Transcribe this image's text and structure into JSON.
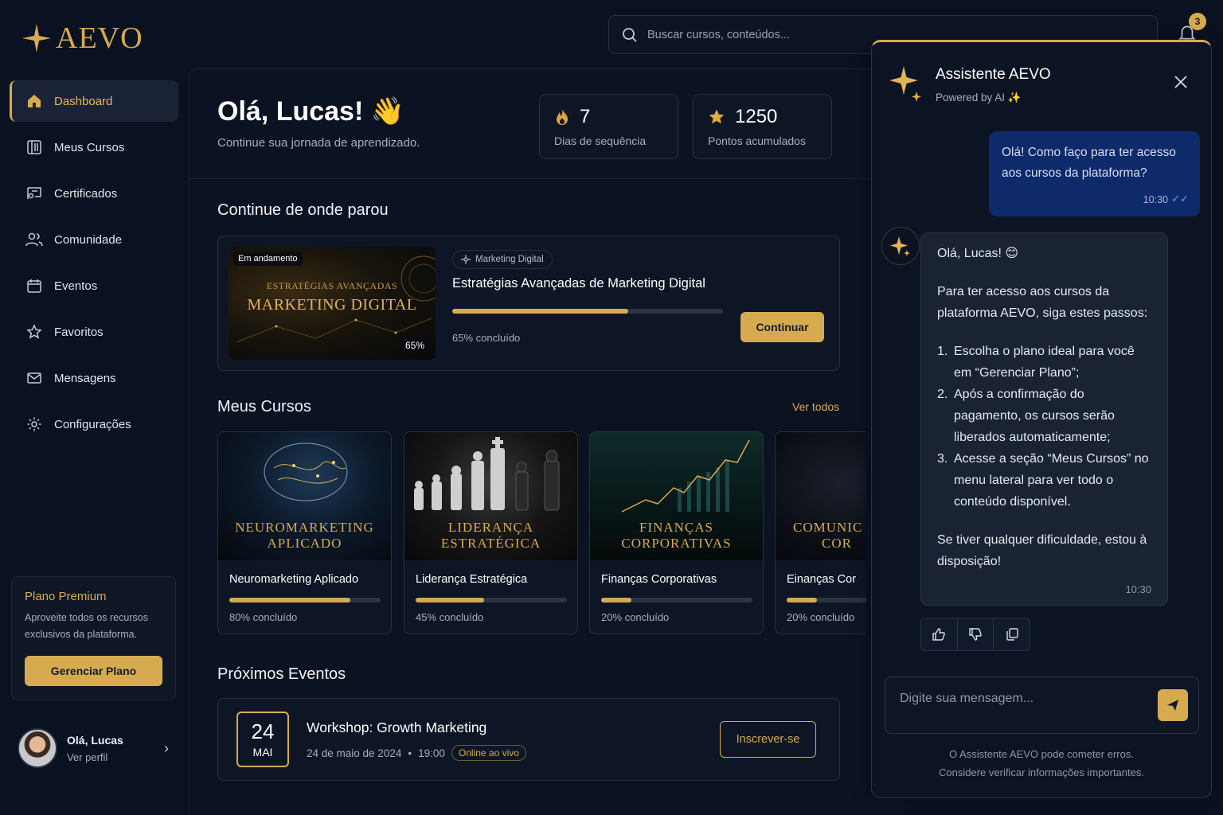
{
  "brand": {
    "name": "AEVO",
    "accent": "#d6ab4f"
  },
  "search": {
    "placeholder": "Buscar cursos, conteúdos..."
  },
  "notifications": {
    "count": "3"
  },
  "sidebar": {
    "items": [
      {
        "label": "Dashboard",
        "icon": "home-icon",
        "active": true
      },
      {
        "label": "Meus Cursos",
        "icon": "books-icon"
      },
      {
        "label": "Certificados",
        "icon": "certificate-icon"
      },
      {
        "label": "Comunidade",
        "icon": "users-icon"
      },
      {
        "label": "Eventos",
        "icon": "calendar-icon"
      },
      {
        "label": "Favoritos",
        "icon": "star-icon"
      },
      {
        "label": "Mensagens",
        "icon": "mail-icon"
      },
      {
        "label": "Configurações",
        "icon": "gear-icon"
      }
    ],
    "plan": {
      "title": "Plano Premium",
      "description": "Aproveite todos os recursos exclusivos da plataforma.",
      "button": "Gerenciar Plano"
    },
    "profile": {
      "name": "Olá, Lucas",
      "link": "Ver perfil"
    }
  },
  "header": {
    "greeting": "Olá, Lucas! 👋",
    "subtitle": "Continue sua jornada de aprendizado.",
    "stats": [
      {
        "value": "7",
        "label": "Dias de sequência",
        "icon": "fire-icon"
      },
      {
        "value": "1250",
        "label": "Pontos acumulados",
        "icon": "star-icon"
      }
    ]
  },
  "continue": {
    "section_title": "Continue de onde parou",
    "badge": "Em andamento",
    "thumb_small": "ESTRATÉGIAS AVANÇADAS",
    "thumb_big": "MARKETING DIGITAL",
    "thumb_pct": "65%",
    "category": "Marketing Digital",
    "title": "Estratégias Avançadas de Marketing Digital",
    "progress": 65,
    "progress_text": "65% concluído",
    "button": "Continuar"
  },
  "courses": {
    "section_title": "Meus Cursos",
    "see_all": "Ver todos",
    "items": [
      {
        "caption_line1": "NEUROMARKETING",
        "caption_line2": "APLICADO",
        "name": "Neuromarketing Aplicado",
        "progress": 80,
        "progress_text": "80% concluído"
      },
      {
        "caption_line1": "LIDERANÇA",
        "caption_line2": "ESTRATÉGICA",
        "name": "Liderança Estratégica",
        "progress": 45,
        "progress_text": "45% concluído"
      },
      {
        "caption_line1": "FINANÇAS",
        "caption_line2": "CORPORATIVAS",
        "name": "Finanças Corporativas",
        "progress": 20,
        "progress_text": "20% concluído"
      },
      {
        "caption_line1": "COMUNIC",
        "caption_line2": "COR",
        "name": "Einanças Cor",
        "progress": 20,
        "progress_text": "20% concluído"
      }
    ]
  },
  "events": {
    "section_title": "Próximos Eventos",
    "items": [
      {
        "day": "24",
        "month": "MAI",
        "title": "Workshop: Growth Marketing",
        "date": "24 de maio de 2024",
        "time": "19:00",
        "tag": "Online ao vivo",
        "button": "Inscrever-se"
      }
    ]
  },
  "chat": {
    "title": "Assistente AEVO",
    "subtitle": "Powered by AI ✨",
    "user_message": "Olá! Como faço para ter acesso aos cursos da plataforma?",
    "user_time": "10:30",
    "bot_greeting": "Olá, Lucas! 😊",
    "bot_intro": "Para ter acesso aos cursos da plataforma AEVO, siga estes passos:",
    "bot_steps": [
      "Escolha o plano ideal para você em “Gerenciar Plano”;",
      "Após a confirmação do pagamento, os cursos serão liberados automaticamente;",
      "Acesse a seção “Meus Cursos” no menu lateral para ver todo o conteúdo disponível."
    ],
    "bot_outro": "Se tiver qualquer dificuldade, estou à disposição!",
    "bot_time": "10:30",
    "input_placeholder": "Digite sua mensagem...",
    "disclaimer_line1": "O Assistente AEVO pode cometer erros.",
    "disclaimer_line2": "Considere verificar informações importantes."
  }
}
